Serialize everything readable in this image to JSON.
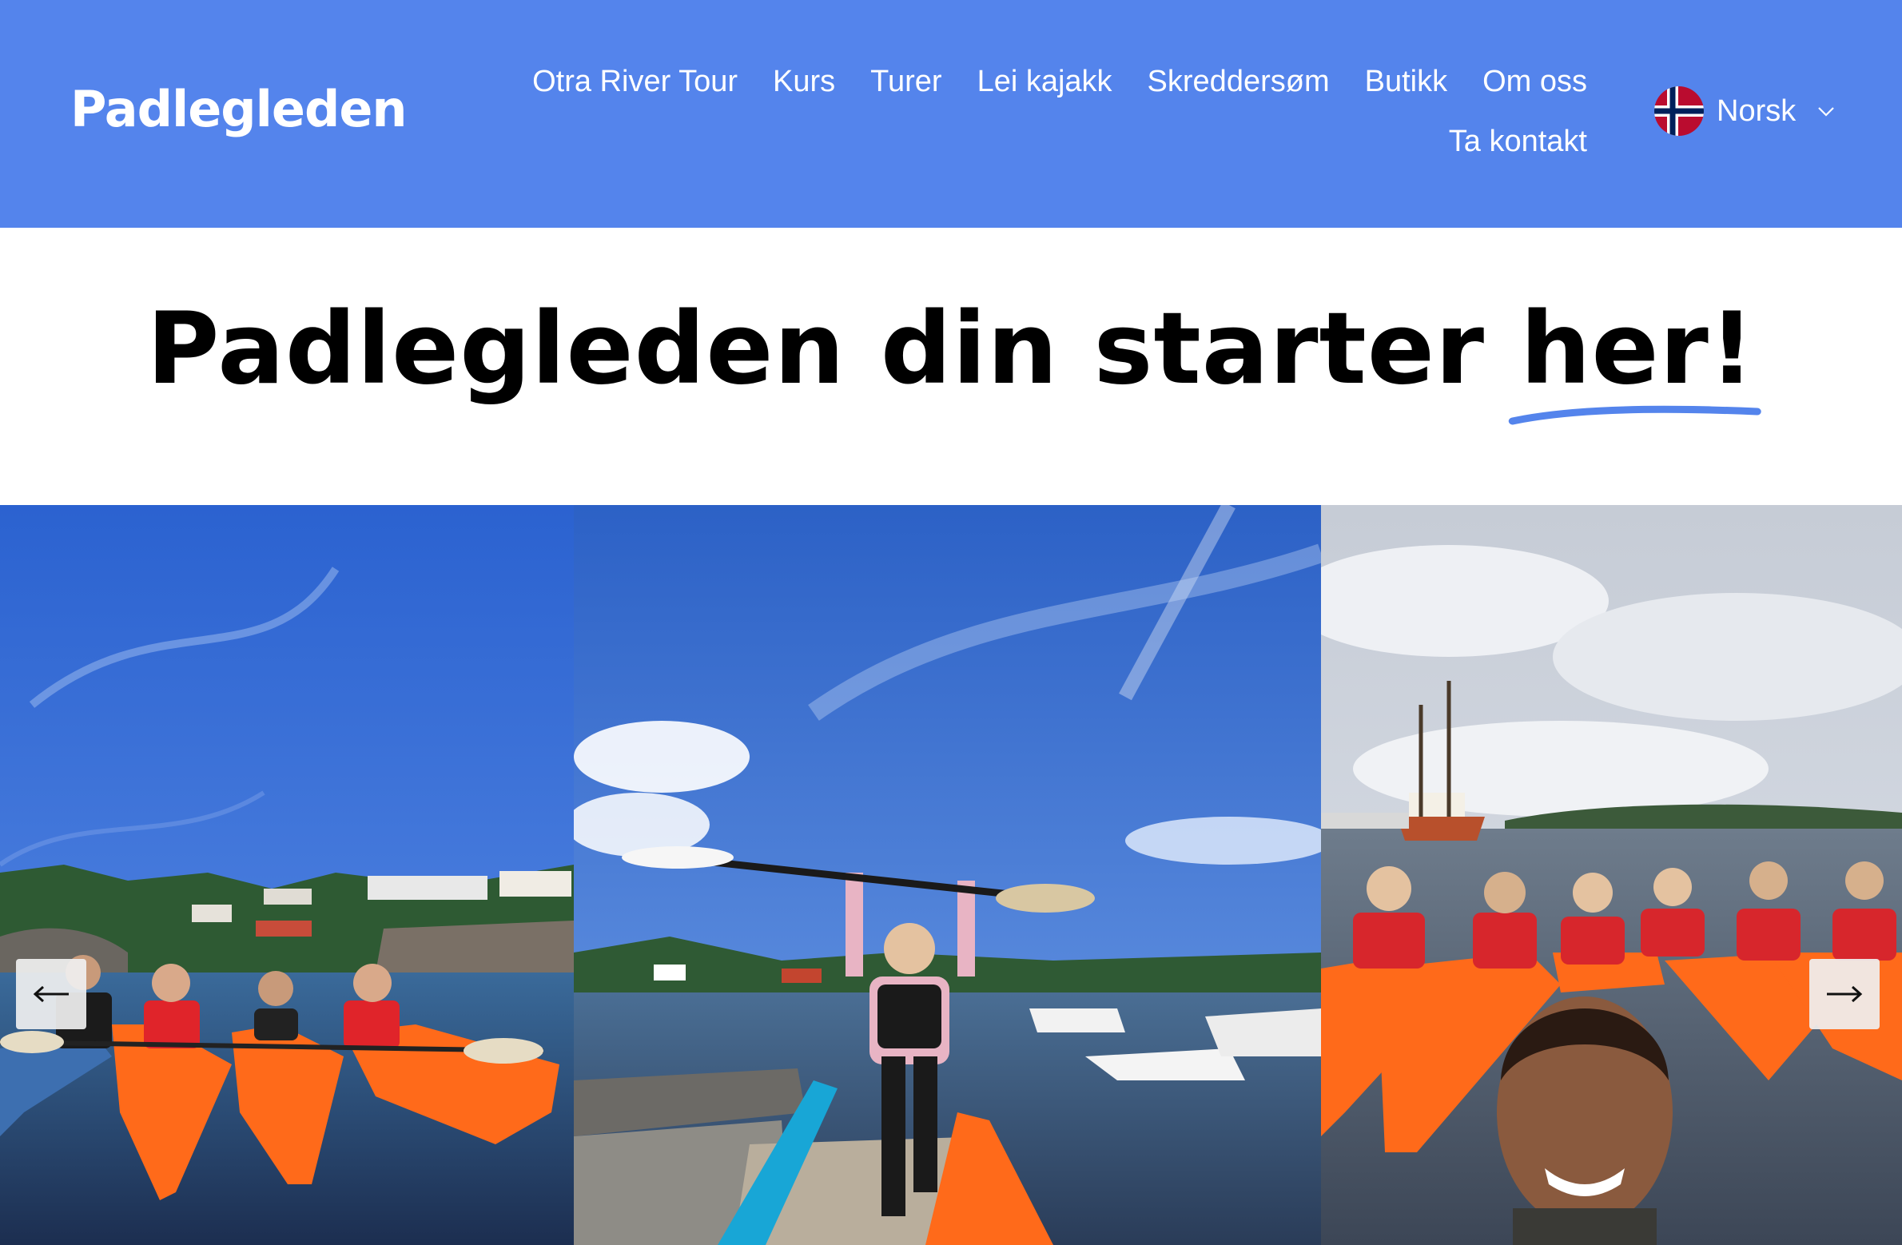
{
  "header": {
    "logo": "Padlegleden",
    "nav": [
      {
        "label": "Otra River Tour"
      },
      {
        "label": "Kurs"
      },
      {
        "label": "Turer"
      },
      {
        "label": "Lei kajakk"
      },
      {
        "label": "Skreddersøm"
      },
      {
        "label": "Butikk"
      },
      {
        "label": "Om oss"
      },
      {
        "label": "Ta kontakt"
      }
    ],
    "language": {
      "label": "Norsk",
      "flag_icon": "norway-flag-icon"
    }
  },
  "hero": {
    "title_main": "Padlegleden din starter ",
    "title_highlight": "her!",
    "underline_color": "#5484ec"
  },
  "gallery": {
    "prev_icon": "arrow-left-icon",
    "next_icon": "arrow-right-icon",
    "slides": [
      {
        "alt_name": "kayak-group-photo-1"
      },
      {
        "alt_name": "paddle-raised-photo"
      },
      {
        "alt_name": "kayak-group-photo-2"
      }
    ]
  },
  "colors": {
    "brand_blue": "#5484ec",
    "text": "#000000",
    "header_text": "#ffffff"
  }
}
